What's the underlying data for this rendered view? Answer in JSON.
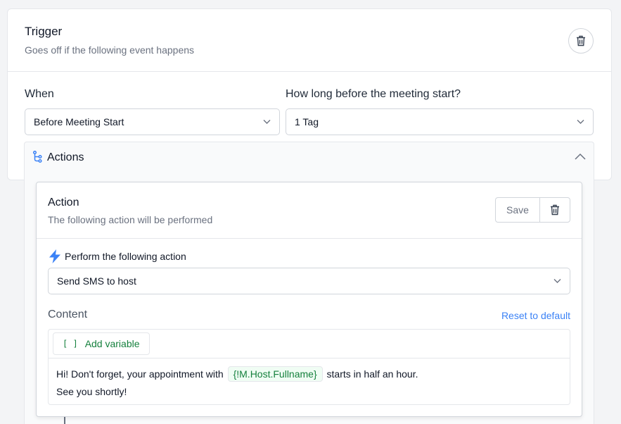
{
  "trigger": {
    "title": "Trigger",
    "subtitle": "Goes off if the following event happens",
    "when_label": "When",
    "when_value": "Before Meeting Start",
    "howlong_label": "How long before the meeting start?",
    "howlong_value": "1 Tag"
  },
  "actions": {
    "title": "Actions"
  },
  "action": {
    "title": "Action",
    "subtitle": "The following action will be performed",
    "save_label": "Save",
    "perform_label": "Perform the following action",
    "perform_value": "Send SMS to host",
    "content_label": "Content",
    "reset_label": "Reset to default",
    "add_variable_label": "Add variable",
    "add_variable_icon": "[ ]",
    "message_part1": "Hi! Don't forget, your appointment with",
    "message_variable": "{!M.Host.Fullname}",
    "message_part2": "starts in half an hour.",
    "message_line2": "See you shortly!"
  },
  "colors": {
    "accent_blue": "#3b82f6",
    "variable_green": "#15803d"
  }
}
